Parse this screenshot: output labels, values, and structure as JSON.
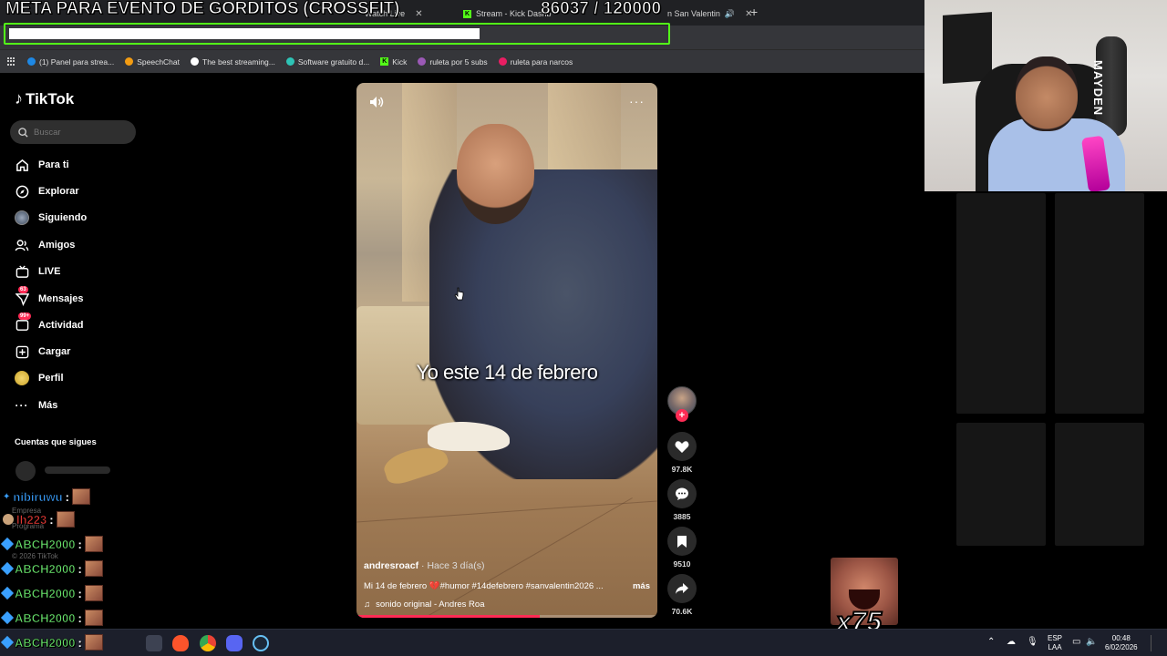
{
  "overlay": {
    "title": "META PARA EVENTO DE GORDITOS (CROSSFIT)",
    "progress_text": "86037  / 120000",
    "progress_fraction": 0.717
  },
  "browser": {
    "tabs": [
      {
        "label": "Watch Live",
        "icon": "tiktok-icon"
      },
      {
        "label": "Stream - Kick Dashb",
        "icon": "kick-icon"
      },
      {
        "label": "n San Valentin",
        "icon": "tiktok-icon"
      }
    ],
    "new_tab": "+",
    "bookmarks": [
      {
        "label": "(1) Panel para strea...",
        "color": "#1e88e5"
      },
      {
        "label": "SpeechChat",
        "color": "#f39c12"
      },
      {
        "label": "The best streaming...",
        "color": "#ffffff"
      },
      {
        "label": "Software gratuito d...",
        "color": "#2ec4b6"
      },
      {
        "label": "Kick",
        "color": "#53fc18"
      },
      {
        "label": "ruleta por 5 subs",
        "color": "#9b59b6"
      },
      {
        "label": "ruleta para narcos",
        "color": "#e91e63"
      }
    ]
  },
  "sidebar": {
    "logo": "TikTok",
    "search_placeholder": "Buscar",
    "nav": [
      {
        "label": "Para ti",
        "icon": "home-icon"
      },
      {
        "label": "Explorar",
        "icon": "compass-icon"
      },
      {
        "label": "Siguiendo",
        "icon": "following-avatar-icon"
      },
      {
        "label": "Amigos",
        "icon": "friends-icon"
      },
      {
        "label": "LIVE",
        "icon": "live-tv-icon"
      },
      {
        "label": "Mensajes",
        "icon": "messages-icon",
        "badge": "63"
      },
      {
        "label": "Actividad",
        "icon": "activity-icon",
        "badge": "99+"
      },
      {
        "label": "Cargar",
        "icon": "upload-icon"
      },
      {
        "label": "Perfil",
        "icon": "profile-icon"
      },
      {
        "label": "Más",
        "icon": "more-icon"
      }
    ],
    "following_title": "Cuentas que sigues",
    "footer": [
      "Empresa",
      "Programa",
      "© 2026 TikTok"
    ]
  },
  "chat": [
    {
      "name": "nibiruwu",
      "color": "#3aa0ff"
    },
    {
      "name": "lh223",
      "color": "#e53935"
    },
    {
      "name": "ABCH2000",
      "color": "#68e36b"
    },
    {
      "name": "ABCH2000",
      "color": "#68e36b"
    },
    {
      "name": "ABCH2000",
      "color": "#68e36b"
    },
    {
      "name": "ABCH2000",
      "color": "#68e36b"
    },
    {
      "name": "ABCH2000",
      "color": "#68e36b"
    }
  ],
  "video": {
    "caption": "Yo este 14 de febrero",
    "author": "andresroacf",
    "posted": "Hace 3 día(s)",
    "description": "Mi 14 de febrero 💔#humor #14defebrero #sanvalentin2026 ...",
    "more_label": "más",
    "sound": "sonido original - Andres Roa",
    "playback_fraction": 0.61
  },
  "actions": {
    "likes": "97.8K",
    "comments": "3885",
    "saves": "9510",
    "shares": "70.6K"
  },
  "emote_multiplier": "x75",
  "webcam": {
    "wall_text": "MAYDEN"
  },
  "taskbar": {
    "language": "ESP",
    "layout": "LAA",
    "time": "00:48",
    "date": "6/02/2026"
  }
}
